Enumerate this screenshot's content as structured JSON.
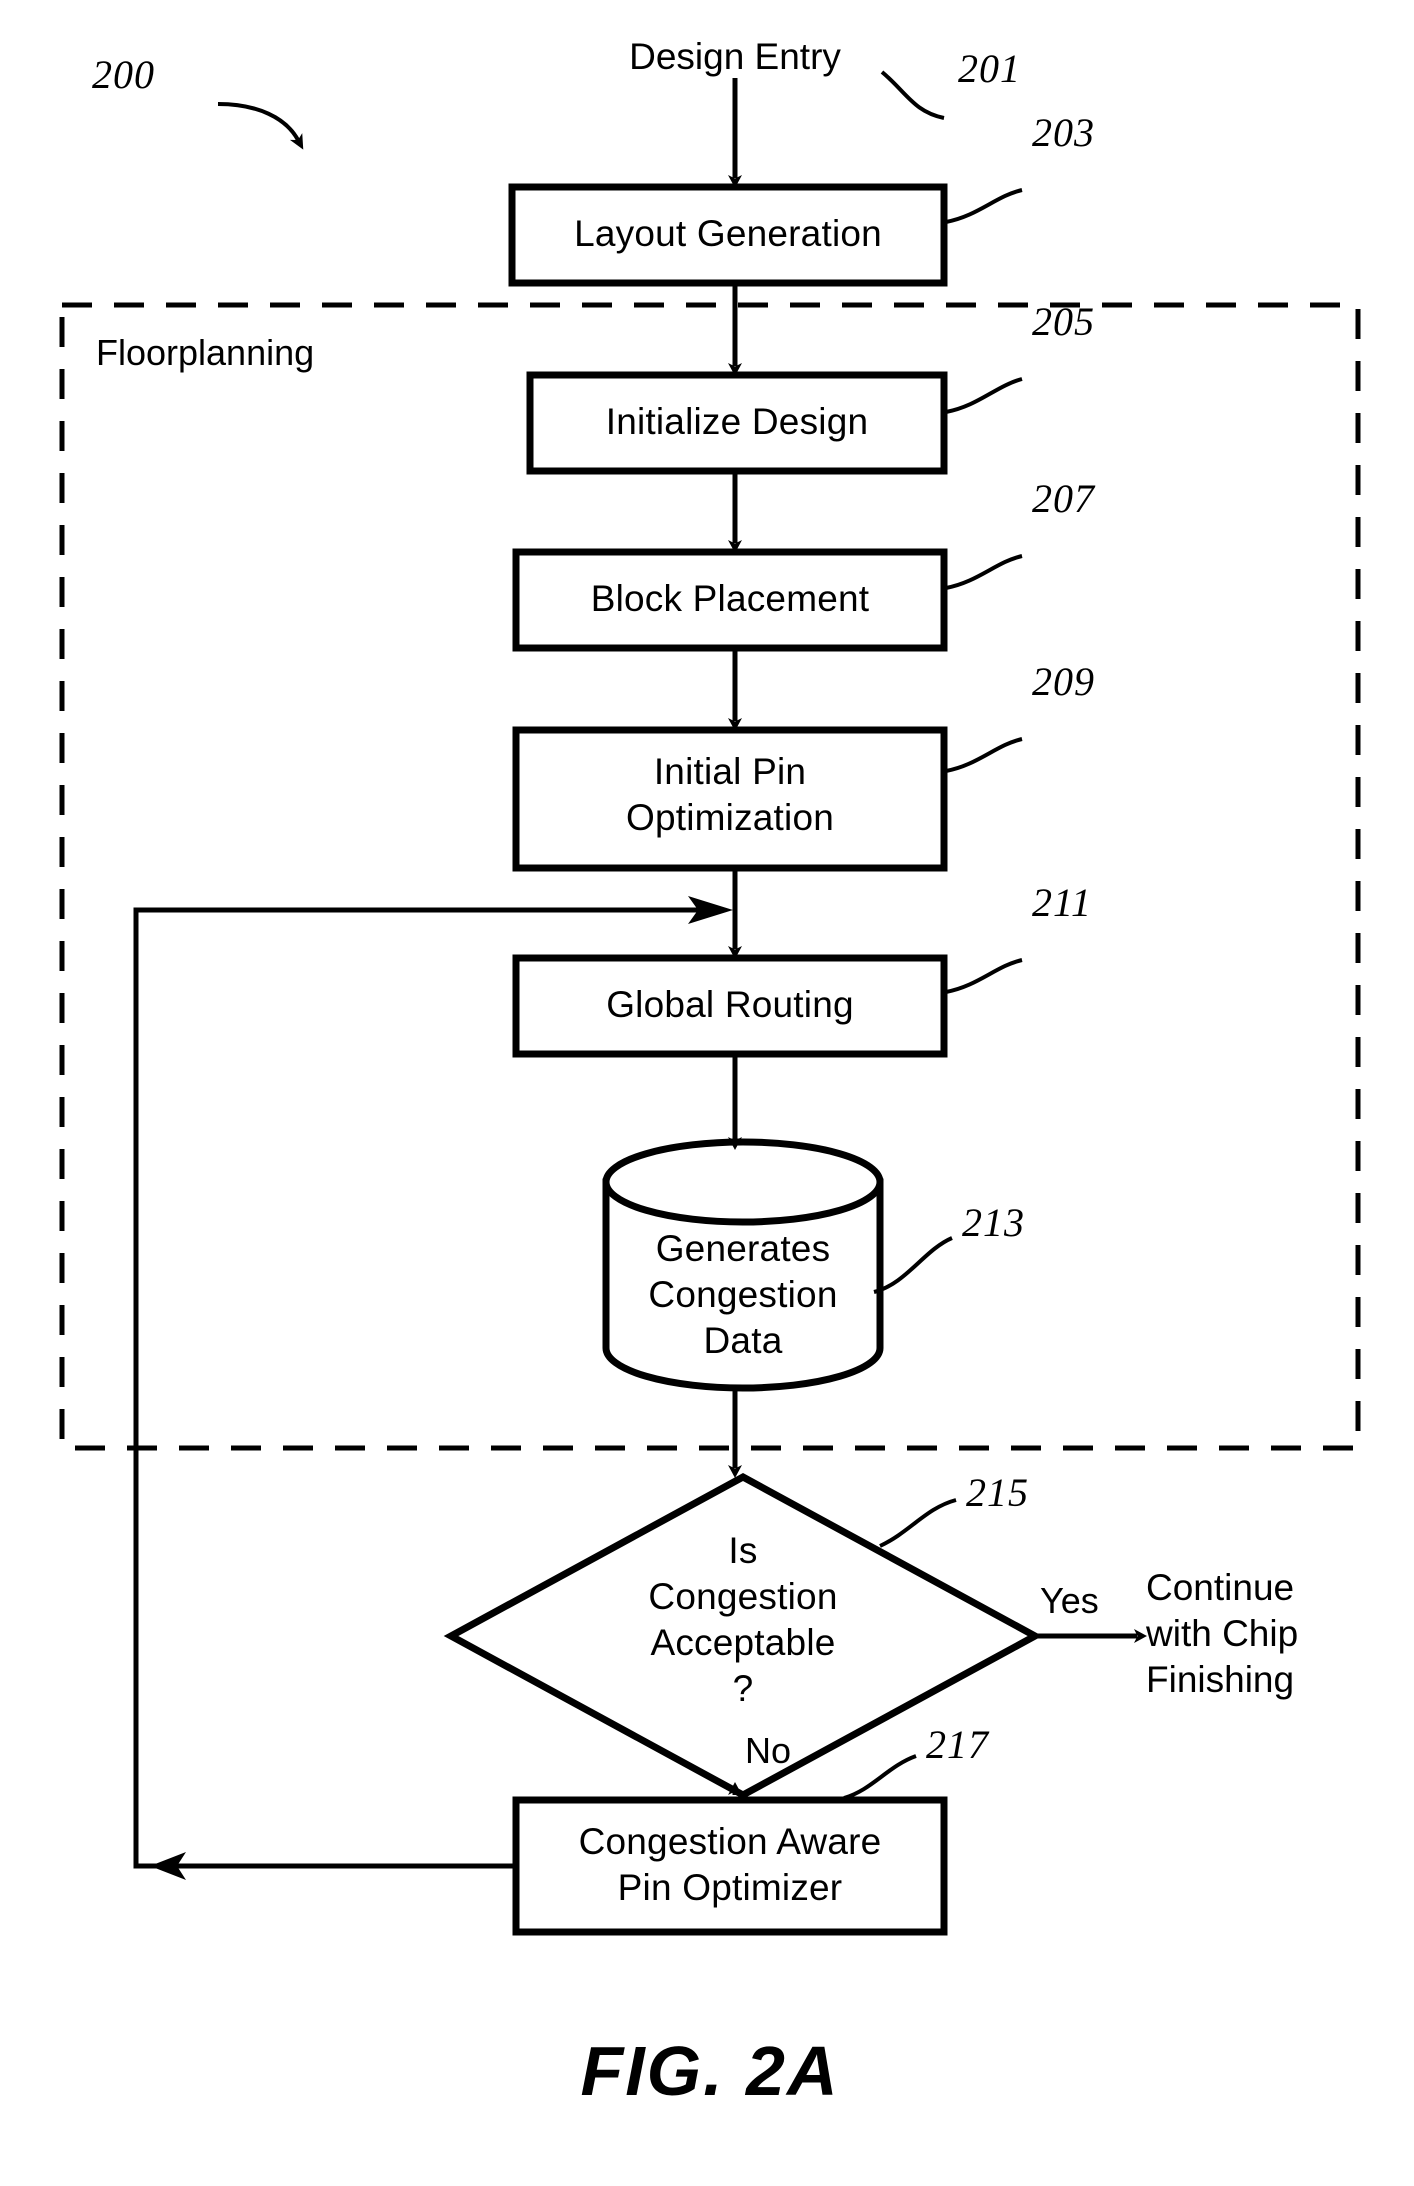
{
  "figure": {
    "caption": "FIG. 2A",
    "diagram_ref": "200",
    "enclosure_label": "Floorplanning"
  },
  "nodes": {
    "design_entry": {
      "label": "Design Entry",
      "ref": "201",
      "shape": "text"
    },
    "layout_generation": {
      "label": "Layout Generation",
      "ref": "203",
      "shape": "process"
    },
    "initialize_design": {
      "label": "Initialize Design",
      "ref": "205",
      "shape": "process"
    },
    "block_placement": {
      "label": "Block Placement",
      "ref": "207",
      "shape": "process"
    },
    "initial_pin_optimization": {
      "line1": "Initial Pin",
      "line2": "Optimization",
      "ref": "209",
      "shape": "process"
    },
    "global_routing": {
      "label": "Global Routing",
      "ref": "211",
      "shape": "process"
    },
    "generates_congestion_data": {
      "line1": "Generates",
      "line2": "Congestion",
      "line3": "Data",
      "ref": "213",
      "shape": "database"
    },
    "is_congestion_acceptable": {
      "line1": "Is",
      "line2": "Congestion",
      "line3": "Acceptable",
      "line4": "?",
      "ref": "215",
      "shape": "decision"
    },
    "congestion_aware_pin_optimizer": {
      "line1": "Congestion Aware",
      "line2": "Pin Optimizer",
      "ref": "217",
      "shape": "process"
    },
    "continue_with_chip_finishing": {
      "line1": "Continue",
      "line2": "with Chip",
      "line3": "Finishing",
      "shape": "text"
    }
  },
  "branches": {
    "yes": "Yes",
    "no": "No"
  },
  "colors": {
    "stroke": "#000000",
    "background": "#ffffff"
  }
}
